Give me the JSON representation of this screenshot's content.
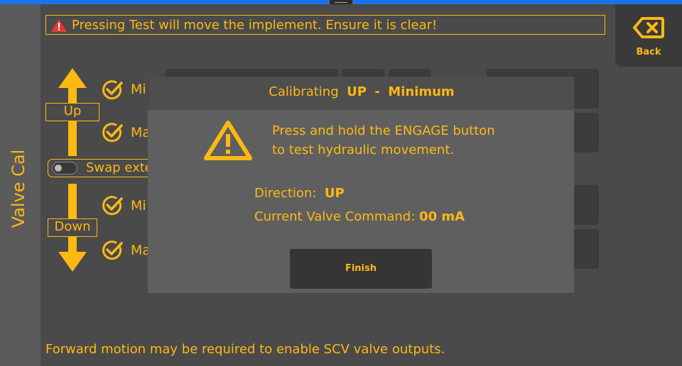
{
  "window": {
    "title": "Valve Cal"
  },
  "warning_banner": {
    "text": "Pressing Test will move the implement. Ensure it is clear!"
  },
  "back_button": {
    "label": "Back"
  },
  "directions": {
    "up_label": "Up",
    "down_label": "Down"
  },
  "rows": [
    {
      "text": "Mi"
    },
    {
      "text": "Ma"
    },
    {
      "text": "Mi"
    },
    {
      "text": "Ma"
    }
  ],
  "swap_toggle": {
    "label": "Swap exte",
    "state": "off"
  },
  "dialog": {
    "title_prefix": "Calibrating",
    "title_direction": "UP",
    "title_sep": "-",
    "title_mode": "Minimum",
    "instruction_line1": "Press and hold the ENGAGE button",
    "instruction_line2": "to test hydraulic movement.",
    "direction_label": "Direction:",
    "direction_value": "UP",
    "command_label": "Current Valve Command:",
    "command_value": "00 mA",
    "finish_label": "Finish"
  },
  "footer": {
    "text": "Forward motion may be required to enable SCV valve outputs."
  },
  "colors": {
    "accent": "#fdb913",
    "background": "#4a4a4a",
    "dialog": "#5f5f5f",
    "alert": "#e53935",
    "titlebar": "#1a73e8"
  },
  "icons": [
    "warning-triangle-icon",
    "backspace-icon",
    "arrow-up-icon",
    "arrow-down-icon",
    "check-circle-icon",
    "warning-icon"
  ]
}
